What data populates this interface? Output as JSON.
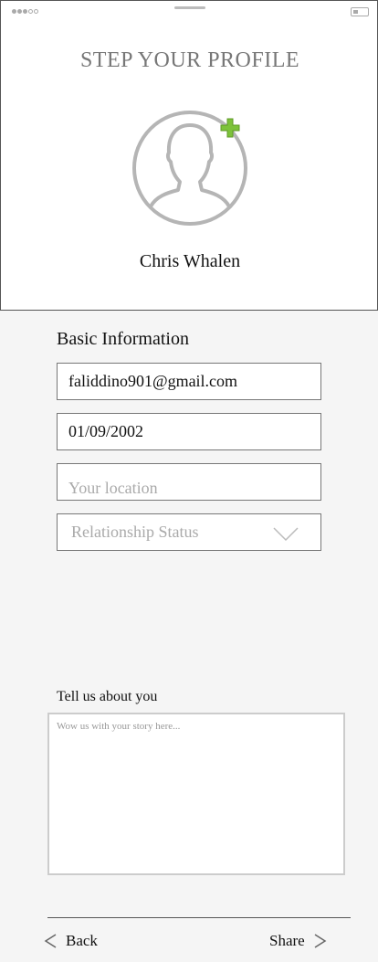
{
  "header": {
    "title": "STEP YOUR PROFILE"
  },
  "profile": {
    "name": "Chris Whalen",
    "avatar_icon": "user-silhouette-icon",
    "add_photo_icon": "plus-icon",
    "accent": "#7dc23a"
  },
  "basic_info": {
    "heading": "Basic Information",
    "email": {
      "value": "faliddino901@gmail.com"
    },
    "dob": {
      "value": "01/09/2002"
    },
    "location": {
      "placeholder": "Your location"
    },
    "relationship": {
      "placeholder": "Relationship Status",
      "icon": "chevron-down-icon"
    }
  },
  "about": {
    "label": "Tell us about you",
    "placeholder": "Wow us with your story here..."
  },
  "footer": {
    "back_label": "Back",
    "share_label": "Share"
  }
}
